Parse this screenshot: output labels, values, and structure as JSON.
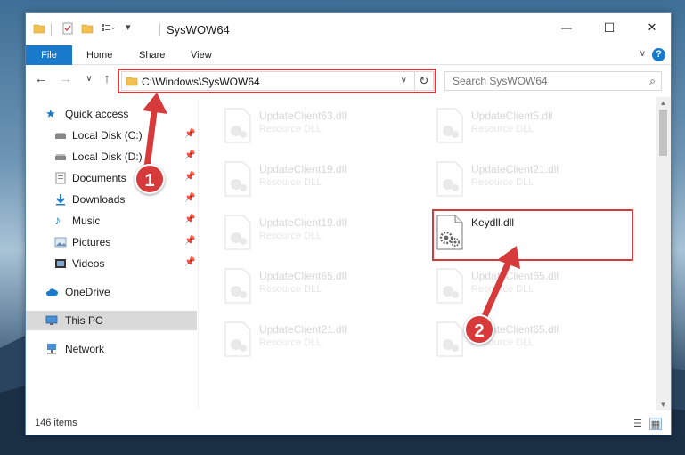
{
  "window": {
    "title": "SysWOW64",
    "minimize_glyph": "—",
    "maximize_glyph": "☐",
    "close_glyph": "✕"
  },
  "ribbon": {
    "tabs": [
      "File",
      "Home",
      "Share",
      "View"
    ],
    "help_label": "?",
    "collapse_glyph": "∨"
  },
  "nav": {
    "back_glyph": "←",
    "forward_glyph": "→",
    "recent_glyph": "∨",
    "up_glyph": "↑",
    "address_path": "C:\\Windows\\SysWOW64",
    "address_dropdown_glyph": "∨",
    "refresh_glyph": "↻",
    "search_placeholder": "Search SysWOW64",
    "search_glyph": "⌕"
  },
  "sidebar": {
    "items": [
      {
        "label": "Quick access",
        "icon": "star-icon",
        "pinned": false
      },
      {
        "label": "Local Disk (C:)",
        "icon": "drive-icon",
        "pinned": true
      },
      {
        "label": "Local Disk (D:)",
        "icon": "drive-icon",
        "pinned": true
      },
      {
        "label": "Documents",
        "icon": "documents-icon",
        "pinned": true
      },
      {
        "label": "Downloads",
        "icon": "downloads-icon",
        "pinned": true
      },
      {
        "label": "Music",
        "icon": "music-icon",
        "pinned": true
      },
      {
        "label": "Pictures",
        "icon": "pictures-icon",
        "pinned": true
      },
      {
        "label": "Videos",
        "icon": "videos-icon",
        "pinned": true
      },
      {
        "label": "OneDrive",
        "icon": "cloud-icon",
        "pinned": false
      },
      {
        "label": "This PC",
        "icon": "computer-icon",
        "pinned": false,
        "selected": true
      },
      {
        "label": "Network",
        "icon": "network-icon",
        "pinned": false
      }
    ],
    "pin_glyph": "📌"
  },
  "files": [
    {
      "name": "UpdateClient63.dll",
      "type": "Resource DLL",
      "highlighted": false
    },
    {
      "name": "UpdateClient5.dll",
      "type": "Resource DLL",
      "highlighted": false
    },
    {
      "name": "UpdateClient19.dll",
      "type": "Resource DLL",
      "highlighted": false
    },
    {
      "name": "UpdateClient21.dll",
      "type": "Resource DLL",
      "highlighted": false
    },
    {
      "name": "UpdateClient19.dll",
      "type": "Resource DLL",
      "highlighted": false
    },
    {
      "name": "Keydll.dll",
      "type": "",
      "highlighted": true
    },
    {
      "name": "UpdateClient65.dll",
      "type": "Resource DLL",
      "highlighted": false
    },
    {
      "name": "UpdateClient65.dll",
      "type": "Resource DLL",
      "highlighted": false
    },
    {
      "name": "UpdateClient21.dll",
      "type": "Resource DLL",
      "highlighted": false
    },
    {
      "name": "UpdateClient65.dll",
      "type": "Resource DLL",
      "highlighted": false
    }
  ],
  "status": {
    "item_count": "146 items"
  },
  "callouts": [
    {
      "number": "1"
    },
    {
      "number": "2"
    }
  ],
  "colors": {
    "accent": "#1979ca",
    "callout_red": "#d63a3a",
    "selected_bg": "#d9d9d9"
  }
}
